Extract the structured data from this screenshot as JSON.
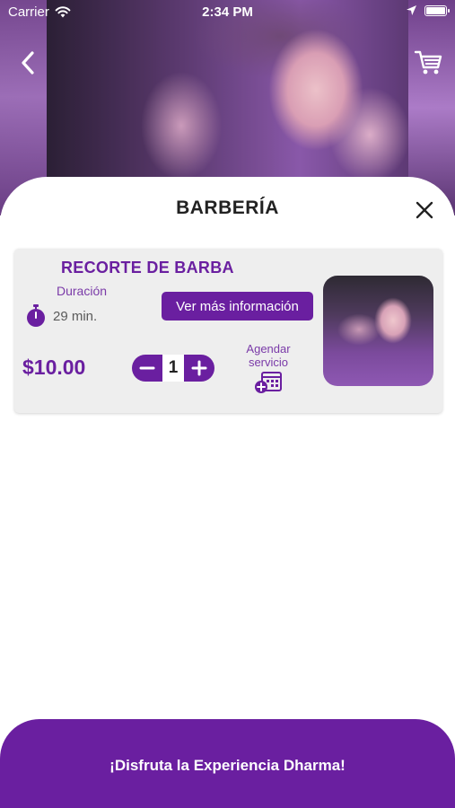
{
  "status_bar": {
    "carrier": "Carrier",
    "time": "2:34 PM"
  },
  "header": {
    "back_icon": "chevron-left-icon",
    "cart_icon": "shopping-cart-icon",
    "title": "BARBERÍA",
    "close_icon": "close-icon"
  },
  "service": {
    "name": "RECORTE DE BARBA",
    "duration_label": "Duración",
    "duration_value": "29 min.",
    "info_button": "Ver más información",
    "price": "$10.00",
    "quantity": "1",
    "schedule_label_line1": "Agendar",
    "schedule_label_line2": "servicio"
  },
  "footer": {
    "text": "¡Disfruta la Experiencia Dharma!"
  },
  "colors": {
    "brand_purple": "#6a1fa0",
    "accent_purple": "#7a3aa8"
  }
}
